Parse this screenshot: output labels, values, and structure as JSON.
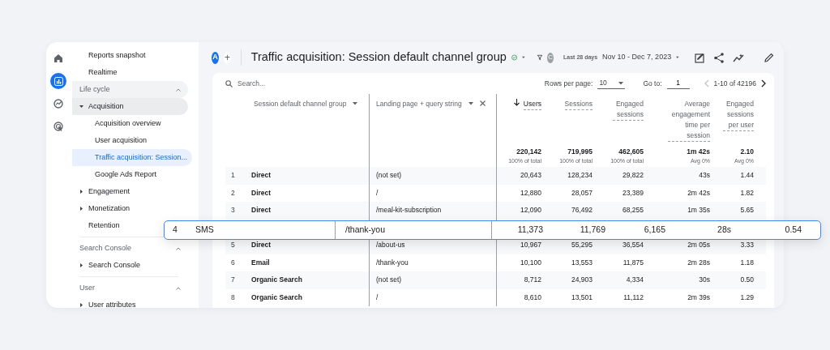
{
  "rail": [
    {
      "kind": "home",
      "selected": false
    },
    {
      "kind": "reports",
      "selected": true
    },
    {
      "kind": "explore",
      "selected": false
    },
    {
      "kind": "advertising",
      "selected": false
    }
  ],
  "sidebar": {
    "sections": [
      {
        "items": [
          {
            "label": "Reports snapshot",
            "selected": false
          },
          {
            "label": "Realtime",
            "selected": false
          }
        ]
      },
      {
        "title": "Life cycle",
        "expanded": true,
        "items": [
          {
            "label": "Acquisition",
            "expanded": true,
            "selected": false,
            "children": [
              {
                "label": "Acquisition overview",
                "selected": false
              },
              {
                "label": "User acquisition",
                "selected": false
              },
              {
                "label": "Traffic acquisition: Session...",
                "selected": true
              },
              {
                "label": "Google Ads Report",
                "selected": false
              }
            ]
          },
          {
            "label": "Engagement",
            "expanded": false,
            "selected": false
          },
          {
            "label": "Monetization",
            "expanded": false,
            "selected": false
          },
          {
            "label": "Retention",
            "selected": false
          }
        ]
      },
      {
        "title": "Search Console",
        "expanded": true,
        "items": [
          {
            "label": "Search Console",
            "expanded": false,
            "selected": false
          }
        ]
      },
      {
        "title": "User",
        "expanded": true,
        "items": [
          {
            "label": "User attributes",
            "expanded": false,
            "selected": false
          }
        ]
      }
    ]
  },
  "header": {
    "avatar": "A",
    "add": "+",
    "title": "Traffic acquisition: Session default channel group",
    "filter_chip": "C",
    "date_label": "Last 28 days",
    "date_range": "Nov 10 - Dec 7, 2023"
  },
  "toolbar": {
    "placeholder": "Search...",
    "rows_per_page_label": "Rows per page:",
    "rows_per_page": "10",
    "goto_label": "Go to:",
    "goto": "1",
    "range": "1-10 of 42196"
  },
  "table": {
    "dimension_columns": [
      "Session default channel group",
      "Landing page + query string"
    ],
    "metric_columns": [
      {
        "label": "Users",
        "sorted": true
      },
      {
        "label": "Sessions",
        "sorted": false
      },
      {
        "label": "Engaged sessions",
        "sorted": false
      },
      {
        "label": "Average engagement time per session",
        "sorted": false
      },
      {
        "label": "Engaged sessions per user",
        "sorted": false
      }
    ],
    "totals": [
      {
        "value": "220,142",
        "note": "100% of total"
      },
      {
        "value": "719,995",
        "note": "100% of total"
      },
      {
        "value": "462,605",
        "note": "100% of total"
      },
      {
        "value": "1m 42s",
        "note": "Avg 0%"
      },
      {
        "value": "2.10",
        "note": "Avg 0%"
      }
    ],
    "rows": [
      {
        "index": "1",
        "channel": "Direct",
        "landing": "(not set)",
        "values": [
          "20,643",
          "128,234",
          "29,822",
          "43s",
          "1.44"
        ],
        "highlighted": false
      },
      {
        "index": "2",
        "channel": "Direct",
        "landing": "/",
        "values": [
          "12,880",
          "28,057",
          "23,389",
          "2m 42s",
          "1.82"
        ],
        "highlighted": false
      },
      {
        "index": "3",
        "channel": "Direct",
        "landing": "/meal-kit-subscription",
        "values": [
          "12,090",
          "76,492",
          "68,255",
          "1m 35s",
          "5.65"
        ],
        "highlighted": false
      },
      {
        "index": "4",
        "channel": "SMS",
        "landing": "/thank-you",
        "values": [
          "11,373",
          "11,769",
          "6,165",
          "28s",
          "0.54"
        ],
        "highlighted": true
      },
      {
        "index": "5",
        "channel": "Direct",
        "landing": "/about-us",
        "values": [
          "10,967",
          "55,295",
          "36,554",
          "2m 05s",
          "3.33"
        ],
        "highlighted": false
      },
      {
        "index": "6",
        "channel": "Email",
        "landing": "/thank-you",
        "values": [
          "10,100",
          "13,553",
          "11,875",
          "2m 28s",
          "1.18"
        ],
        "highlighted": false
      },
      {
        "index": "7",
        "channel": "Organic Search",
        "landing": "(not set)",
        "values": [
          "8,712",
          "24,903",
          "4,334",
          "30s",
          "0.50"
        ],
        "highlighted": false
      },
      {
        "index": "8",
        "channel": "Organic Search",
        "landing": "/",
        "values": [
          "8,610",
          "13,501",
          "11,112",
          "2m 39s",
          "1.29"
        ],
        "highlighted": false
      }
    ]
  }
}
